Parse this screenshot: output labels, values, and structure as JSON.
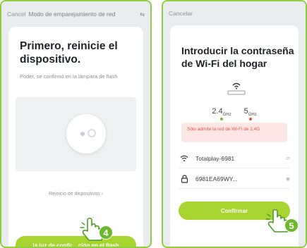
{
  "left": {
    "cancel": "Cancel",
    "title": "Modo de emparejamiento de red",
    "heading": "Primero, reinicie el dispositivo.",
    "subtext": "Poder, se confirmó en la lámpara de flash",
    "reset_link": "Reinicio de dispositivos ›",
    "button": "la luz de confir... ción en el flash",
    "step": "4"
  },
  "right": {
    "cancel": "Cancelar",
    "heading": "Introducir la contraseña de Wi-Fi del hogar",
    "band_24": "2.4",
    "band_5": "5",
    "band_unit": "GHz",
    "warning": "Sólo admite la red de Wi-Fi de 2,4G",
    "ssid": "Totalplay-6981",
    "password": "6981EA69WY...",
    "button": "Confirmar",
    "step": "5"
  },
  "colors": {
    "accent": "#a7d42e",
    "border": "#8fce3a",
    "step": "#6db82c",
    "warn_bg": "#fde7e4",
    "warn_text": "#e4503a"
  }
}
